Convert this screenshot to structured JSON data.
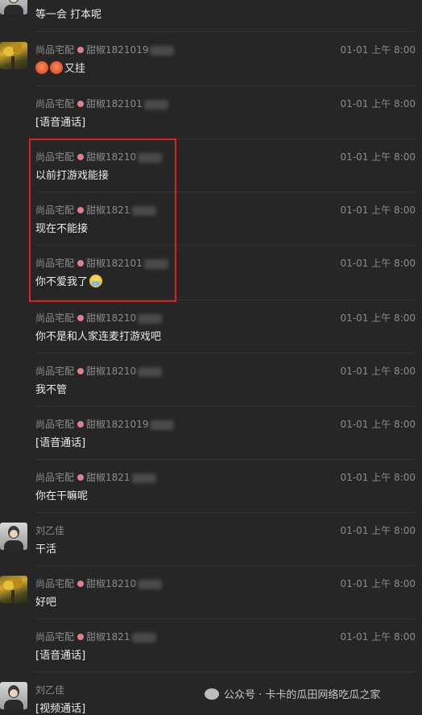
{
  "messages": [
    {
      "sender": "",
      "time": "",
      "text": "等一会 打本呢",
      "avatar": "person",
      "emoji": []
    },
    {
      "sender": "尚品宅配",
      "handle": "甜椒1821019",
      "time": "01-01 上午 8:00",
      "text": "又挂",
      "avatar": "tree",
      "emoji": [
        "angry-face",
        "angry-face"
      ]
    },
    {
      "sender": "尚品宅配",
      "handle": "甜椒182101",
      "time": "01-01 上午 8:00",
      "text": "[语音通话]",
      "avatar": "",
      "emoji": []
    },
    {
      "sender": "尚品宅配",
      "handle": "甜椒18210",
      "time": "01-01 上午 8:00",
      "text": "以前打游戏能接",
      "avatar": "",
      "emoji": []
    },
    {
      "sender": "尚品宅配",
      "handle": "甜椒1821",
      "time": "01-01 上午 8:00",
      "text": "现在不能接",
      "avatar": "",
      "emoji": []
    },
    {
      "sender": "尚品宅配",
      "handle": "甜椒182101",
      "time": "01-01 上午 8:00",
      "text": "你不爱我了",
      "avatar": "",
      "emoji": [
        "crying-face"
      ]
    },
    {
      "sender": "尚品宅配",
      "handle": "甜椒18210",
      "time": "01-01 上午 8:00",
      "text": "你不是和人家连麦打游戏吧",
      "avatar": "",
      "emoji": []
    },
    {
      "sender": "尚品宅配",
      "handle": "甜椒18210",
      "time": "01-01 上午 8:00",
      "text": "我不管",
      "avatar": "",
      "emoji": []
    },
    {
      "sender": "尚品宅配",
      "handle": "甜椒1821019",
      "time": "01-01 上午 8:00",
      "text": "[语音通话]",
      "avatar": "",
      "emoji": []
    },
    {
      "sender": "尚品宅配",
      "handle": "甜椒1821",
      "time": "01-01 上午 8:00",
      "text": "你在干嘛呢",
      "avatar": "",
      "emoji": []
    },
    {
      "sender": "刘乙佳",
      "handle": "",
      "time": "01-01 上午 8:00",
      "text": "干活",
      "avatar": "person",
      "emoji": []
    },
    {
      "sender": "尚品宅配",
      "handle": "甜椒18210",
      "time": "01-01 上午 8:00",
      "text": "好吧",
      "avatar": "tree",
      "emoji": []
    },
    {
      "sender": "尚品宅配",
      "handle": "甜椒1821",
      "time": "01-01 上午 8:00",
      "text": "[语音通话]",
      "avatar": "",
      "emoji": []
    },
    {
      "sender": "刘乙佳",
      "handle": "",
      "time": "01-01 上午 8:00",
      "text": "[视频通话]",
      "avatar": "person",
      "emoji": []
    }
  ],
  "watermark": "公众号 · 卡卡的瓜田网络吃瓜之家",
  "colors": {
    "background": "#262626",
    "highlight": "#e02020",
    "meta_text": "#8c8c8c",
    "message_text": "#ececec"
  }
}
